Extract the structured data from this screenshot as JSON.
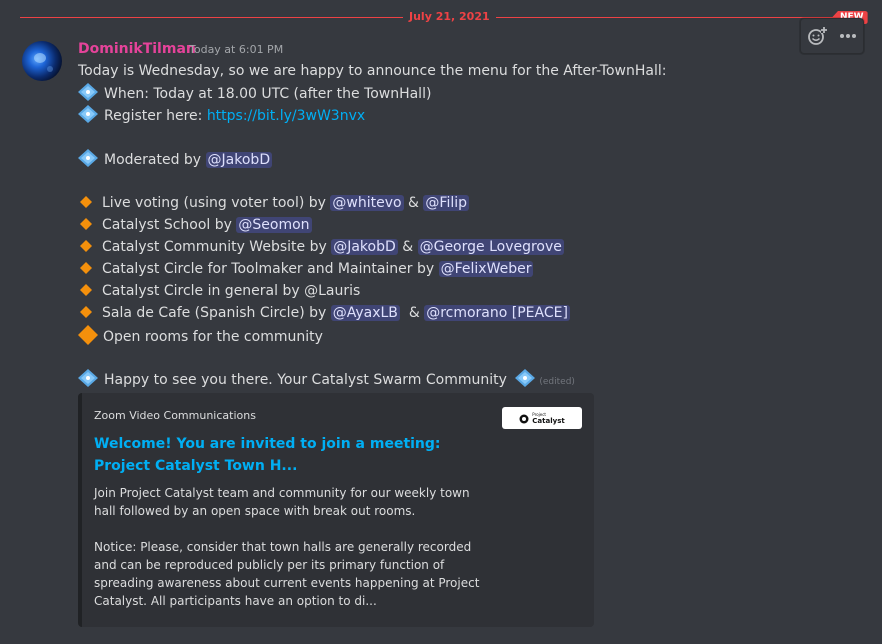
{
  "divider": {
    "date": "July 21, 2021",
    "badge": "NEW"
  },
  "message": {
    "author": "DominikTilman",
    "timestamp": "Today at 6:01 PM",
    "lines": {
      "intro": "Today is Wednesday, so we are happy to announce the menu for the After-TownHall:",
      "when": "When: Today at 18.00 UTC (after the TownHall)",
      "register_label": "Register here: ",
      "register_link": "https://bit.ly/3wW3nvx",
      "moderated_label": "Moderated by ",
      "moderated_mention": "@JakobD",
      "item1_text": "Live voting (using voter tool) by ",
      "item1_m1": "@whitevo",
      "item1_amp": " & ",
      "item1_m2": "@Filip",
      "item2_text": "Catalyst School by ",
      "item2_m1": "@Seomon",
      "item3_text": "Catalyst Community Website by ",
      "item3_m1": "@JakobD",
      "item3_amp": " & ",
      "item3_m2": "@George Lovegrove",
      "item4_text": "Catalyst Circle for Toolmaker and Maintainer by ",
      "item4_m1": "@FelixWeber",
      "item5_text": "Catalyst Circle in general by @Lauris",
      "item6_text": "Sala de Cafe (Spanish Circle) by ",
      "item6_m1": "@AyaxLB",
      "item6_amp": "  & ",
      "item6_m2": "@rcmorano [PEACE]",
      "item7_text": "Open rooms for the community",
      "closing": "Happy to see you there. Your Catalyst Swarm Community",
      "edited": "(edited)"
    }
  },
  "embed": {
    "provider": "Zoom Video Communications",
    "title": "Welcome! You are invited to join a meeting: Project Catalyst Town H...",
    "desc1": "Join Project Catalyst team and community for our weekly town hall followed by an open space with break out rooms.",
    "desc2": "Notice: Please, consider that town halls are generally recorded and can be reproduced publicly per its primary function of spreading awareness about current events happening at Project Catalyst. All participants have an option to di...",
    "thumb_small": "Project",
    "thumb_big": "Catalyst"
  },
  "icons": {
    "diamond": "diamond-shape-with-dot-icon",
    "bullet": "small-orange-diamond-icon",
    "large_bullet": "large-orange-diamond-icon",
    "add_reaction": "add-reaction-icon",
    "more": "more-options-icon"
  },
  "colors": {
    "background": "#36393f",
    "author": "#e5439a",
    "divider": "#ed4245",
    "link": "#00aff4",
    "mention_bg": "#414675"
  }
}
